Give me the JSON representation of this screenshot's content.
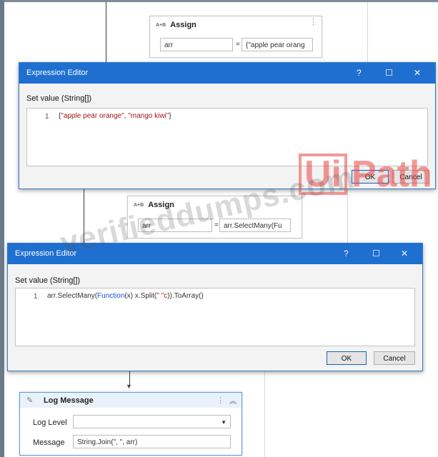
{
  "assign_top": {
    "title": "Assign",
    "to_value": "arr",
    "equals": "=",
    "value": "{\"apple pear orang"
  },
  "editor_1": {
    "title": "Expression Editor",
    "help": "?",
    "maximize": "☐",
    "close": "✕",
    "label": "Set value (String[])",
    "line_number": "1",
    "code_open": "{",
    "code_str1": "\"apple pear orange\"",
    "code_sep": ", ",
    "code_str2": "\"mango kiwi\"",
    "code_close": "}",
    "ok": "OK",
    "cancel": "Cancel"
  },
  "assign_mid": {
    "title": "Assign",
    "to_value": "arr",
    "equals": "=",
    "value": "arr.SelectMany(Fu"
  },
  "editor_2": {
    "title": "Expression Editor",
    "help": "?",
    "maximize": "☐",
    "close": "✕",
    "label": "Set value (String[])",
    "line_number": "1",
    "code_a": "arr.SelectMany(",
    "code_kw": "Function",
    "code_b": "(x) x.Split(",
    "code_str": "\" \"c",
    "code_c": ")).ToArray()",
    "ok": "OK",
    "cancel": "Cancel"
  },
  "log_message": {
    "title": "Log Message",
    "level_label": "Log Level",
    "level_value": "",
    "message_label": "Message",
    "message_value": "String.Join(\", \", arr)"
  },
  "watermark": {
    "text": "verifieddumps.com",
    "logo_ui": "Ui",
    "logo_path": "Path"
  },
  "colors": {
    "titlebar": "#1f6fd1",
    "string_literal": "#a31515",
    "keyword": "#1b4fd8",
    "accent_border": "#5a9bd8"
  }
}
